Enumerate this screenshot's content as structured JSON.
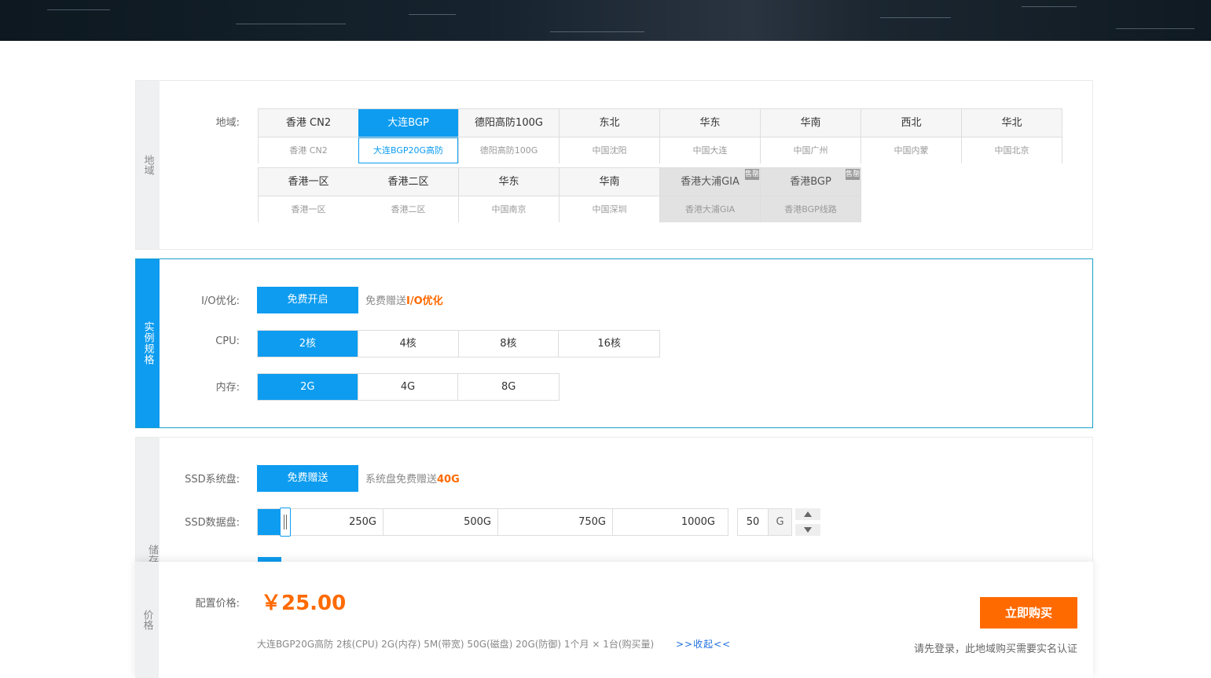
{
  "region": {
    "section_label": "地域",
    "field_label": "地域:",
    "row1": [
      {
        "name": "香港 CN2",
        "desc": "香港 CN2",
        "state": "normal"
      },
      {
        "name": "大连BGP",
        "desc": "大连BGP20G高防",
        "state": "selected"
      },
      {
        "name": "德阳高防100G",
        "desc": "德阳高防100G",
        "state": "normal"
      },
      {
        "name": "东北",
        "desc": "中国沈阳",
        "state": "normal"
      },
      {
        "name": "华东",
        "desc": "中国大连",
        "state": "normal"
      },
      {
        "name": "华南",
        "desc": "中国广州",
        "state": "normal"
      },
      {
        "name": "西北",
        "desc": "中国内蒙",
        "state": "normal"
      },
      {
        "name": "华北",
        "desc": "中国北京",
        "state": "normal"
      }
    ],
    "row2": [
      {
        "name": "香港一区",
        "desc": "香港一区",
        "state": "normal"
      },
      {
        "name": "香港二区",
        "desc": "香港二区",
        "state": "normal"
      },
      {
        "name": "华东",
        "desc": "中国南京",
        "state": "normal"
      },
      {
        "name": "华南",
        "desc": "中国深圳",
        "state": "normal"
      },
      {
        "name": "香港大浦GIA",
        "desc": "香港大浦GIA",
        "state": "disabled",
        "badge": "售罄"
      },
      {
        "name": "香港BGP",
        "desc": "香港BGP线路",
        "state": "disabled",
        "badge": "售罄"
      }
    ]
  },
  "spec": {
    "section_label": "实例规格",
    "io_label": "I/O优化:",
    "io_button": "免费开启",
    "io_note_prefix": "免费赠送",
    "io_note_highlight": "I/O优化",
    "cpu_label": "CPU:",
    "cpu_options": [
      "2核",
      "4核",
      "8核",
      "16核"
    ],
    "cpu_selected": 0,
    "mem_label": "内存:",
    "mem_options": [
      "2G",
      "4G",
      "8G"
    ],
    "mem_selected": 0
  },
  "storage": {
    "section_label": "储存",
    "sys_label": "SSD系统盘:",
    "sys_button": "免费赠送",
    "sys_note_prefix": "系统盘免费赠送",
    "sys_note_highlight": "40G",
    "data_label": "SSD数据盘:",
    "ticks": [
      "250G",
      "500G",
      "750G",
      "1000G"
    ],
    "max": 1000,
    "value": 50,
    "unit": "G"
  },
  "price": {
    "section_label": "价格",
    "label": "配置价格:",
    "amount": "￥25.00",
    "summary": "大连BGP20G高防  2核(CPU)  2G(内存)  5M(带宽)  50G(磁盘)  20G(防御)  1个月 × 1台(购买量)",
    "collapse": ">>收起<<",
    "buy": "立即购买",
    "login_note": "请先登录，此地域购买需要实名认证"
  },
  "colors": {
    "accent": "#0d9cf0",
    "orange": "#ff6a00"
  }
}
